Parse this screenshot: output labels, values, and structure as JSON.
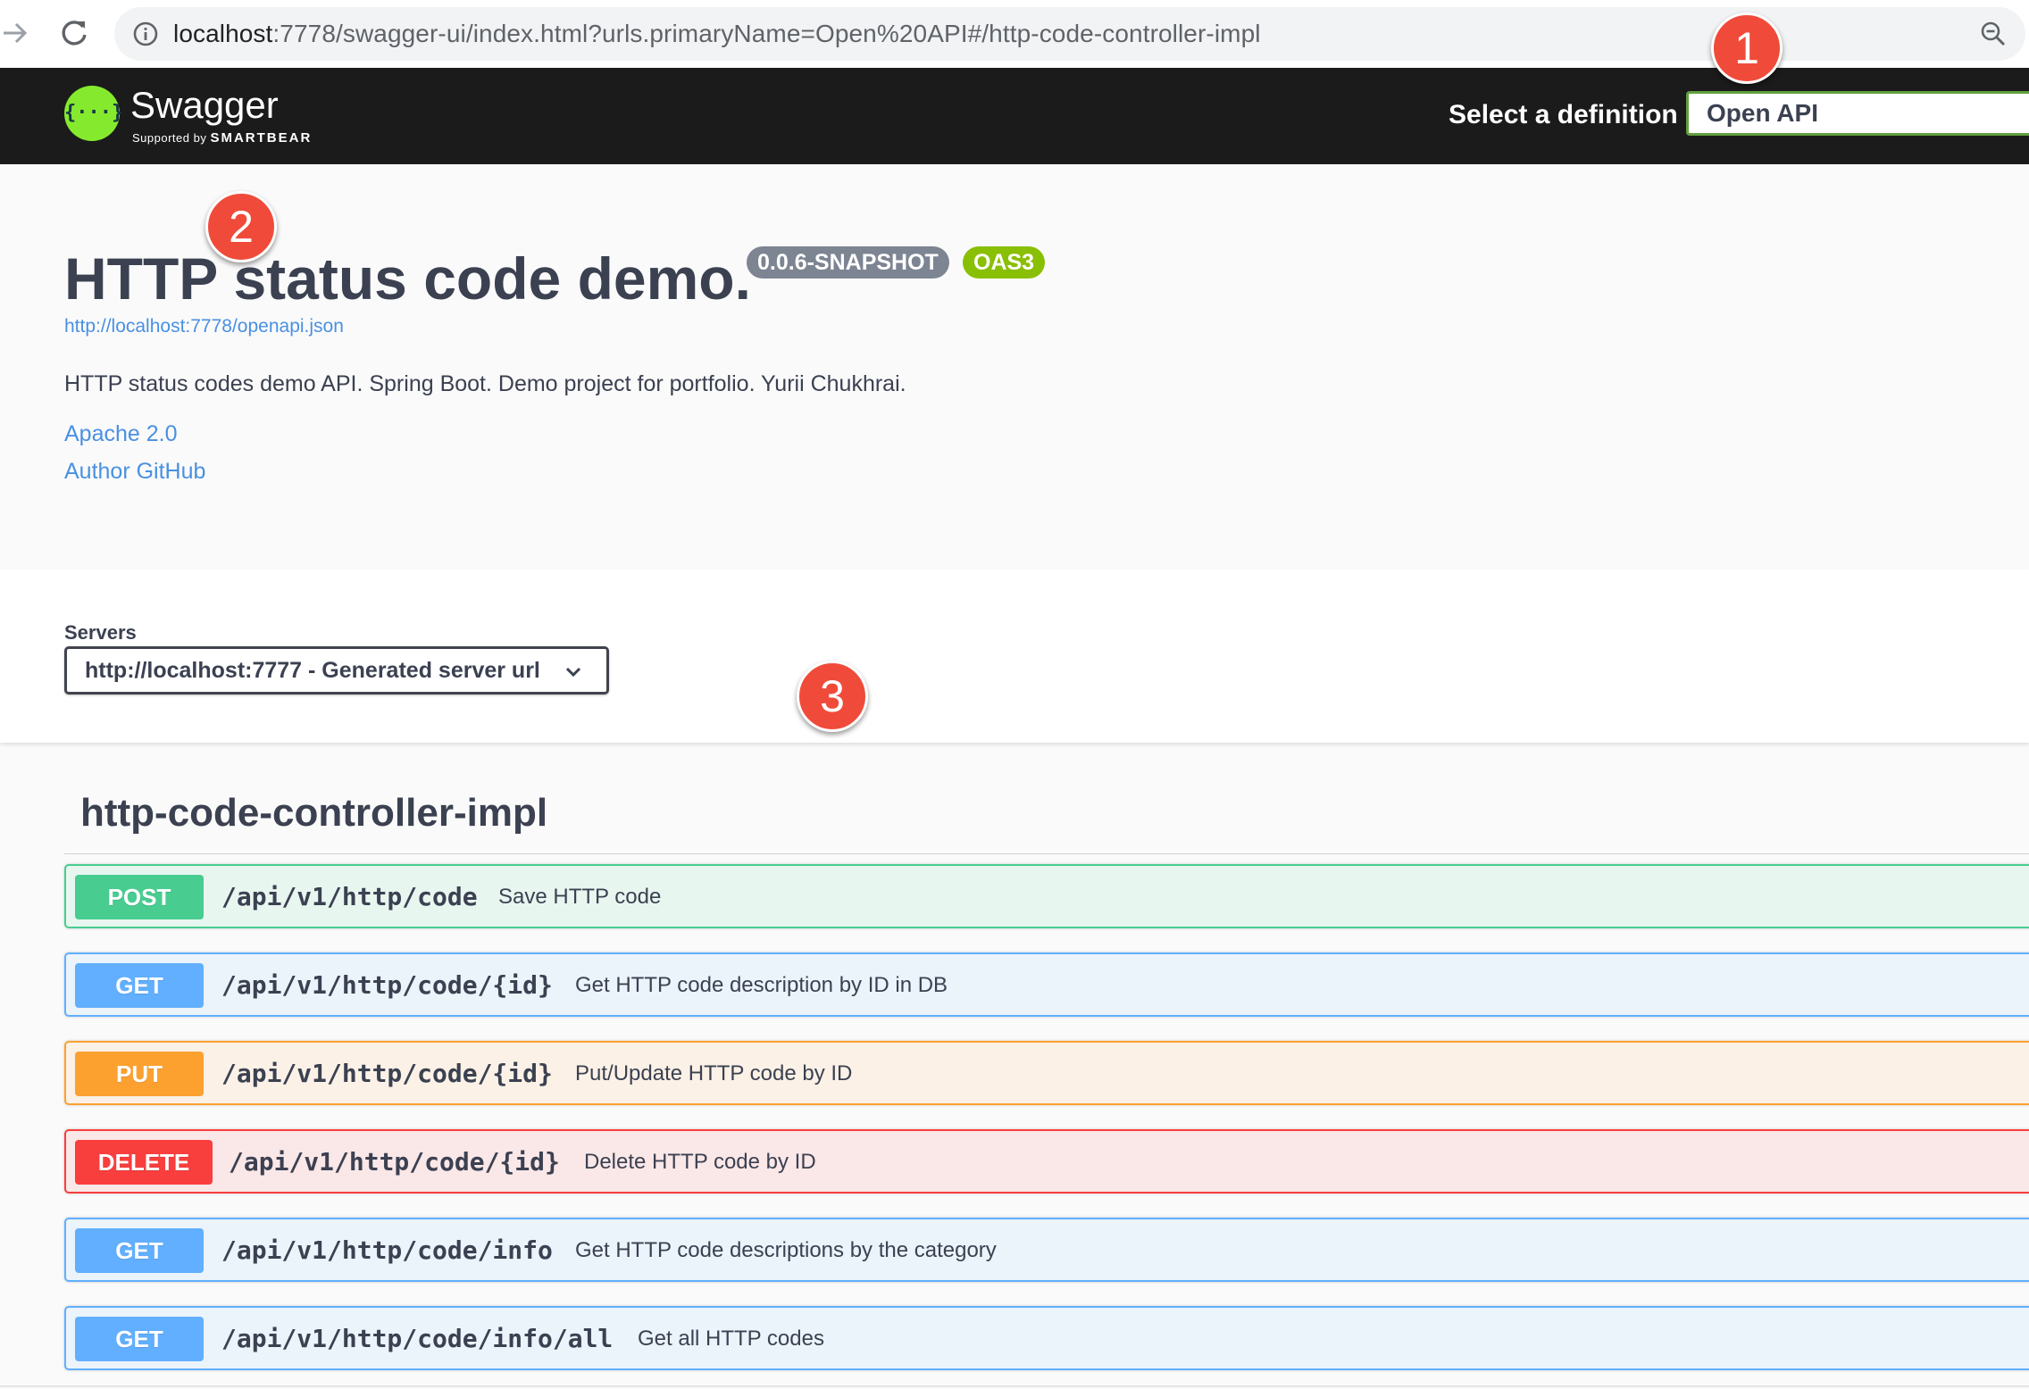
{
  "browser": {
    "url_host": "localhost",
    "url_rest": ":7778/swagger-ui/index.html?urls.primaryName=Open%20API#/http-code-controller-impl"
  },
  "topbar": {
    "logo_glyph": "{···}",
    "logo_name": "Swagger",
    "logo_supported": "Supported by",
    "logo_company": "SMARTBEAR",
    "definition_label": "Select a definition",
    "definition_value": "Open API"
  },
  "info": {
    "title": "HTTP status code demo.",
    "version_badge": "0.0.6-SNAPSHOT",
    "oas_badge": "OAS3",
    "spec_url": "http://localhost:7778/openapi.json",
    "description": "HTTP status codes demo API. Spring Boot. Demo project for portfolio. Yurii Chukhrai.",
    "license_link": "Apache 2.0",
    "author_link": "Author GitHub"
  },
  "servers": {
    "label": "Servers",
    "selected": "http://localhost:7777 - Generated server url"
  },
  "operations": {
    "tag": "http-code-controller-impl",
    "items": [
      {
        "method": "POST",
        "path": "/api/v1/http/code",
        "summary": "Save HTTP code"
      },
      {
        "method": "GET",
        "path": "/api/v1/http/code/{id}",
        "summary": "Get HTTP code description by ID in DB"
      },
      {
        "method": "PUT",
        "path": "/api/v1/http/code/{id}",
        "summary": "Put/Update HTTP code by ID"
      },
      {
        "method": "DELETE",
        "path": "/api/v1/http/code/{id}",
        "summary": "Delete HTTP code by ID"
      },
      {
        "method": "GET",
        "path": "/api/v1/http/code/info",
        "summary": "Get HTTP code descriptions by the category"
      },
      {
        "method": "GET",
        "path": "/api/v1/http/code/info/all",
        "summary": "Get all HTTP codes"
      }
    ]
  },
  "callouts": [
    "1",
    "2",
    "3"
  ],
  "colors": {
    "post": "#49cc90",
    "get": "#61affe",
    "put": "#fca130",
    "delete": "#f93e3e",
    "topbar": "#1b1b1b",
    "link": "#4990e2",
    "callout": "#f04b3a"
  }
}
